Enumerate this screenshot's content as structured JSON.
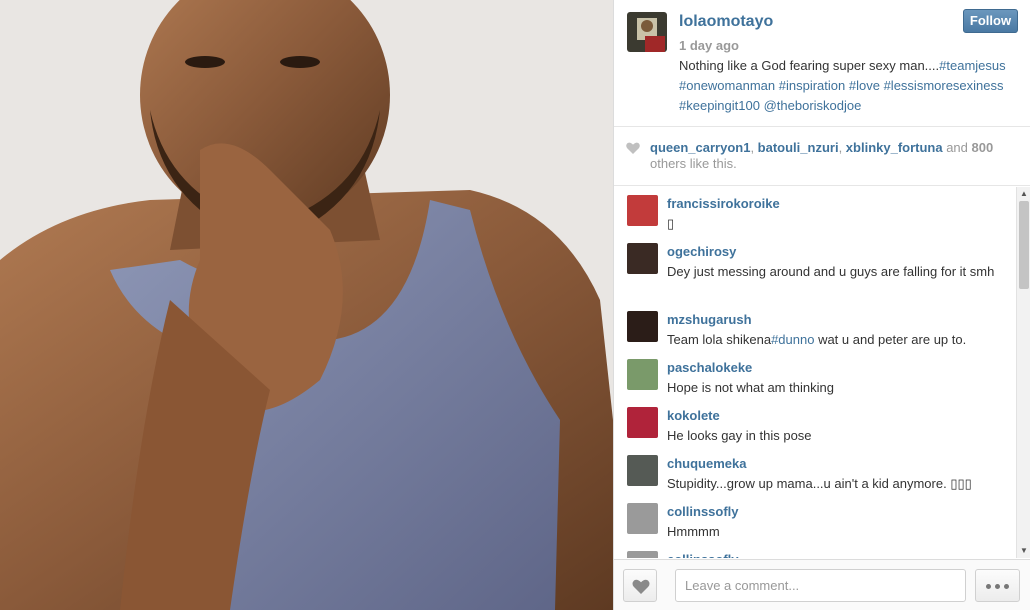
{
  "post": {
    "owner": "lolaomotayo",
    "time": "1 day ago",
    "follow_label": "Follow",
    "caption_segments": [
      {
        "text": "Nothing like a God fearing super sexy man....",
        "tag": false
      },
      {
        "text": "#teamjesus",
        "tag": true
      },
      {
        "text": " ",
        "tag": false
      },
      {
        "text": "#onewomanman",
        "tag": true
      },
      {
        "text": " ",
        "tag": false
      },
      {
        "text": "#inspiration",
        "tag": true
      },
      {
        "text": " ",
        "tag": false
      },
      {
        "text": "#love",
        "tag": true
      },
      {
        "text": " ",
        "tag": false
      },
      {
        "text": "#lessismoresexiness",
        "tag": true
      },
      {
        "text": " ",
        "tag": false
      },
      {
        "text": "#keepingit100",
        "tag": true
      },
      {
        "text": " ",
        "tag": false
      },
      {
        "text": "@theboriskodjoe",
        "tag": true
      }
    ]
  },
  "likes": {
    "users": [
      "queen_carryon1",
      "batouli_nzuri",
      "xblinky_fortuna"
    ],
    "sep1": ", ",
    "sep2": ", ",
    "and_text": " and ",
    "count": "800",
    "suffix": " others like this."
  },
  "comments": [
    {
      "user": "francissirokoroike",
      "text": "▯",
      "avatar_color": "#c23b3b"
    },
    {
      "user": "ogechirosy",
      "text": "Dey just messing around and u guys are falling for it smh",
      "avatar_color": "#3a2a24"
    },
    {
      "user": "mzshugarush",
      "text_segments": [
        {
          "text": "Team lola shikena",
          "tag": false
        },
        {
          "text": "#dunno",
          "tag": true
        },
        {
          "text": " wat u and peter are up to.",
          "tag": false
        }
      ],
      "avatar_color": "#2b1d18"
    },
    {
      "user": "paschalokeke",
      "text": "Hope is not what am thinking",
      "avatar_color": "#7a9a6a"
    },
    {
      "user": "kokolete",
      "text": "He looks gay in this pose",
      "avatar_color": "#b0233a"
    },
    {
      "user": "chuquemeka",
      "text": "Stupidity...grow up mama...u ain't a kid anymore. ▯▯▯",
      "avatar_color": "#555a55"
    },
    {
      "user": "collinssofly",
      "text": "Hmmmm",
      "avatar_color": "#9a9a9a"
    },
    {
      "user": "collinssofly",
      "text": "",
      "avatar_color": "#9a9a9a"
    }
  ],
  "input": {
    "placeholder": "Leave a comment..."
  },
  "icons": {
    "heart": "heart-icon",
    "more": "more-options-icon",
    "scroll_up": "▲",
    "scroll_down": "▼"
  },
  "colors": {
    "link": "#3f729b",
    "muted": "#999999",
    "follow_bg": "#4a79a3"
  }
}
